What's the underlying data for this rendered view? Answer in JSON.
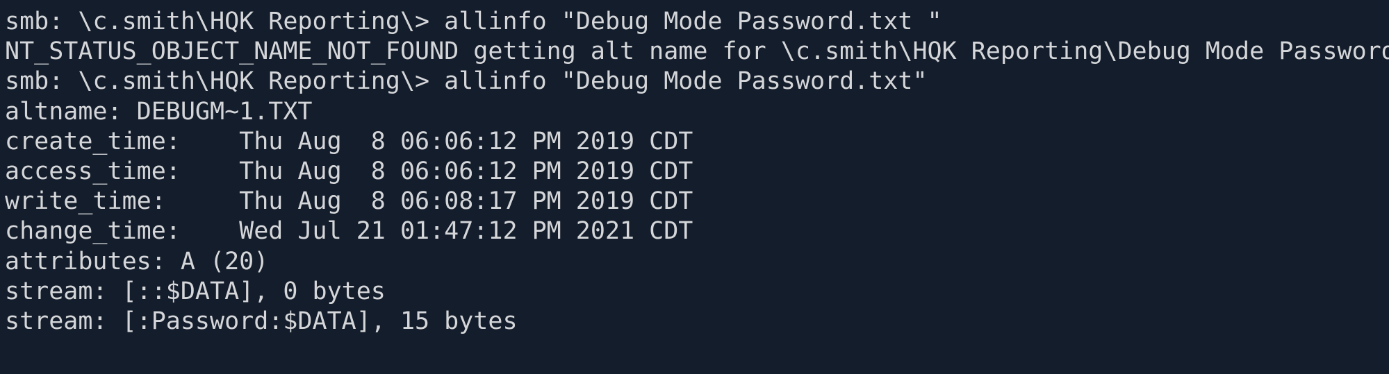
{
  "terminal": {
    "background": "#141d2b",
    "foreground": "#d4d6d9",
    "lines": [
      "smb: \\c.smith\\HQK Reporting\\> allinfo \"Debug Mode Password.txt \"",
      "NT_STATUS_OBJECT_NAME_NOT_FOUND getting alt name for \\c.smith\\HQK Reporting\\Debug Mode Password.txt",
      "smb: \\c.smith\\HQK Reporting\\> allinfo \"Debug Mode Password.txt\"",
      "altname: DEBUGM~1.TXT",
      "create_time:    Thu Aug  8 06:06:12 PM 2019 CDT",
      "access_time:    Thu Aug  8 06:06:12 PM 2019 CDT",
      "write_time:     Thu Aug  8 06:08:17 PM 2019 CDT",
      "change_time:    Wed Jul 21 01:47:12 PM 2021 CDT",
      "attributes: A (20)",
      "stream: [::$DATA], 0 bytes",
      "stream: [:Password:$DATA], 15 bytes"
    ]
  }
}
